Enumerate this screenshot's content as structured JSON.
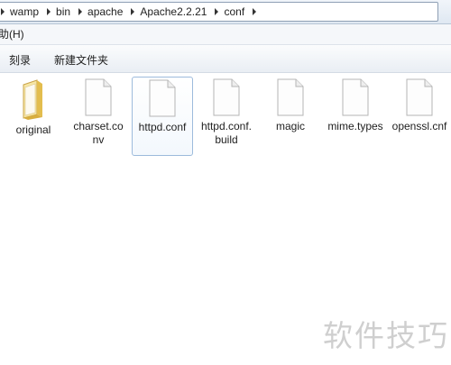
{
  "address_bar": {
    "crumbs": [
      "wamp",
      "bin",
      "apache",
      "Apache2.2.21",
      "conf"
    ]
  },
  "menu": {
    "help": "助(H)"
  },
  "toolbar": {
    "burn": "刻录",
    "new_folder": "新建文件夹"
  },
  "files": [
    {
      "name": "original",
      "type": "folder",
      "icon": "folder-icon"
    },
    {
      "name": "charset.conv",
      "type": "file",
      "icon": "file-icon"
    },
    {
      "name": "httpd.conf",
      "type": "file",
      "icon": "file-icon",
      "selected": true
    },
    {
      "name": "httpd.conf.build",
      "type": "file",
      "icon": "file-icon"
    },
    {
      "name": "magic",
      "type": "file",
      "icon": "file-icon"
    },
    {
      "name": "mime.types",
      "type": "file",
      "icon": "file-icon"
    },
    {
      "name": "openssl.cnf",
      "type": "file",
      "icon": "file-icon"
    }
  ],
  "watermark": "软件技巧",
  "colors": {
    "selection_border": "#9dbbdc",
    "folder": "#e8c65a"
  }
}
